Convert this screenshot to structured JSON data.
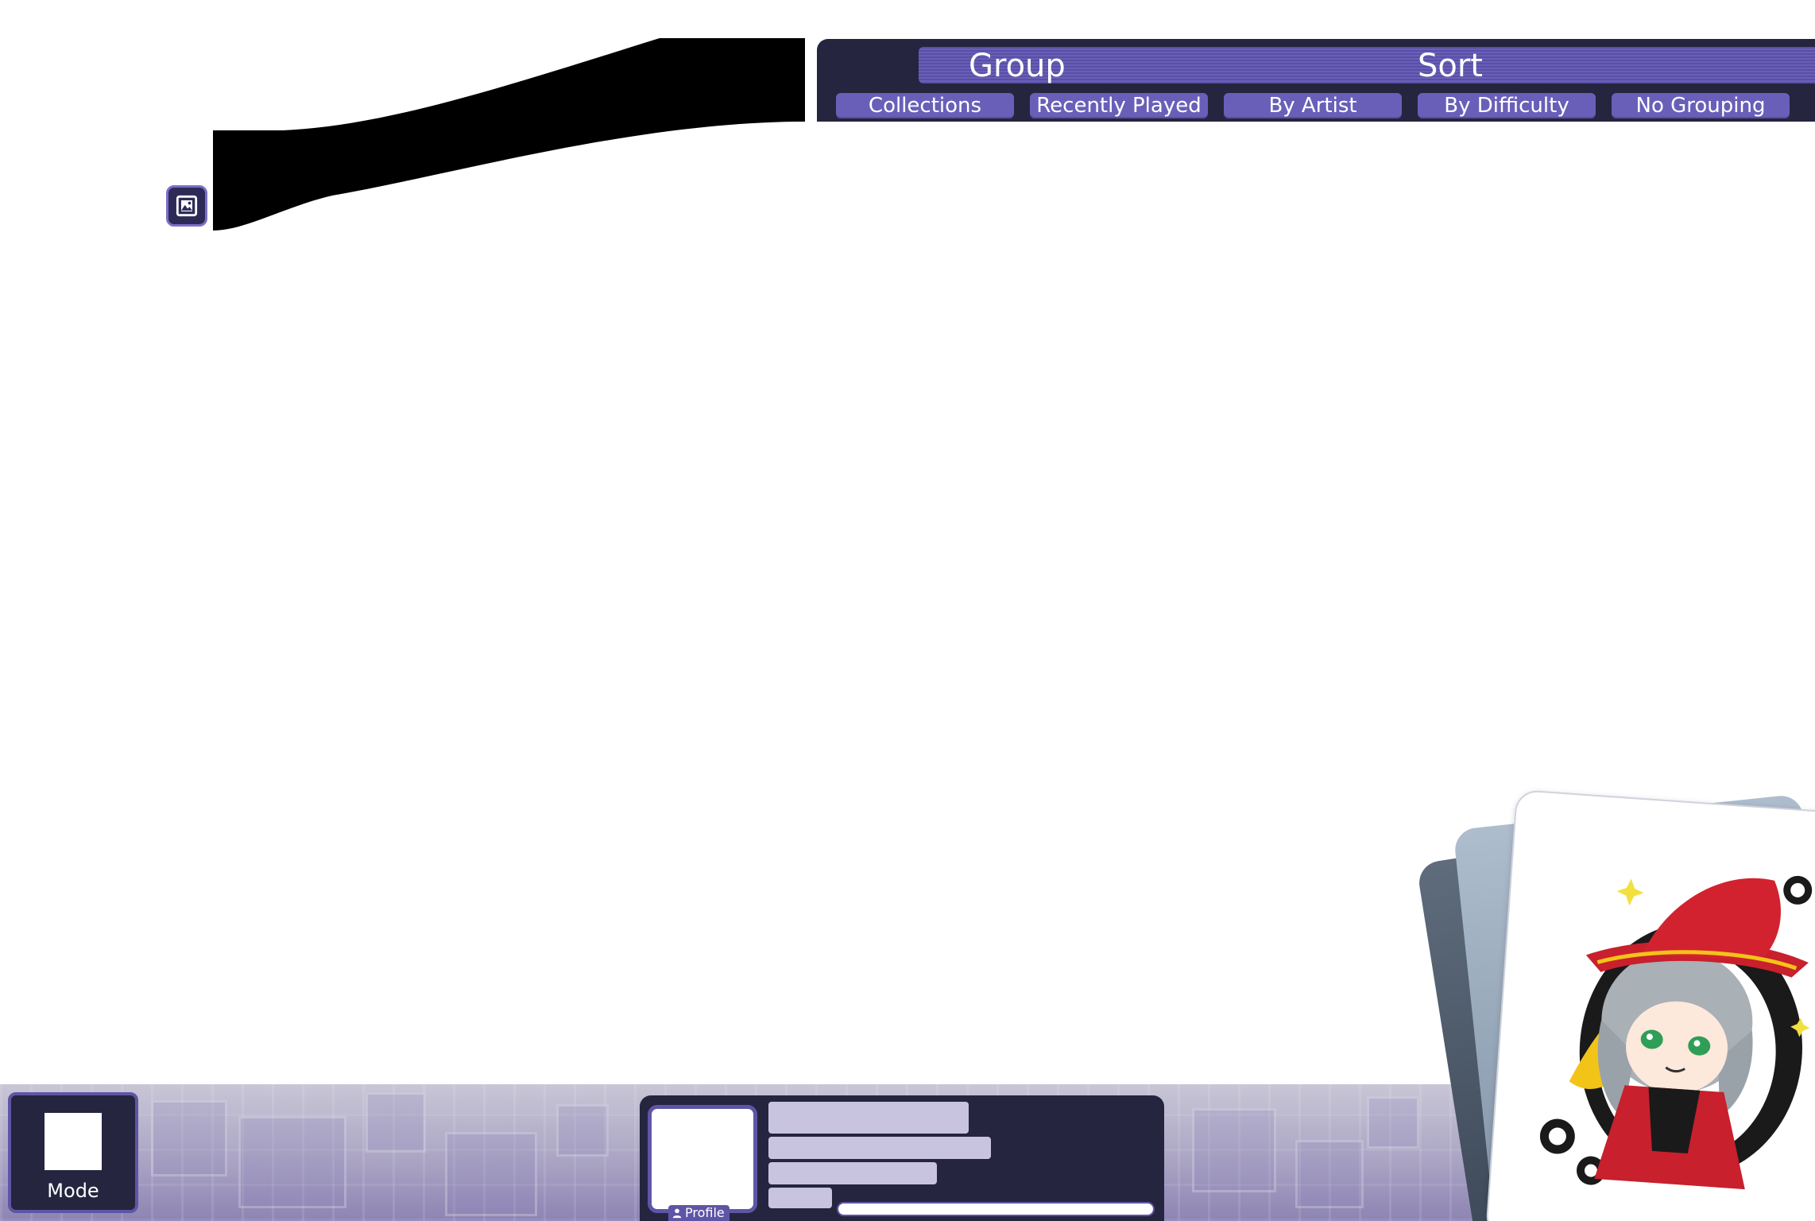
{
  "panel": {
    "group_title": "Group",
    "sort_title": "Sort",
    "options": [
      {
        "label": "Collections"
      },
      {
        "label": "Recently Played"
      },
      {
        "label": "By Artist"
      },
      {
        "label": "By Difficulty"
      },
      {
        "label": "No Grouping"
      }
    ]
  },
  "footer": {
    "mode_label": "Mode",
    "profile_label": "Profile"
  },
  "icons": {
    "background_toggle": "image-icon",
    "mode": "mode-icon",
    "profile": "person-icon"
  },
  "colors": {
    "panel_dark": "#25253f",
    "accent_purple": "#6a5fb8",
    "accent_border": "#5f55a6",
    "placeholder_bar": "#c8c4e0"
  }
}
